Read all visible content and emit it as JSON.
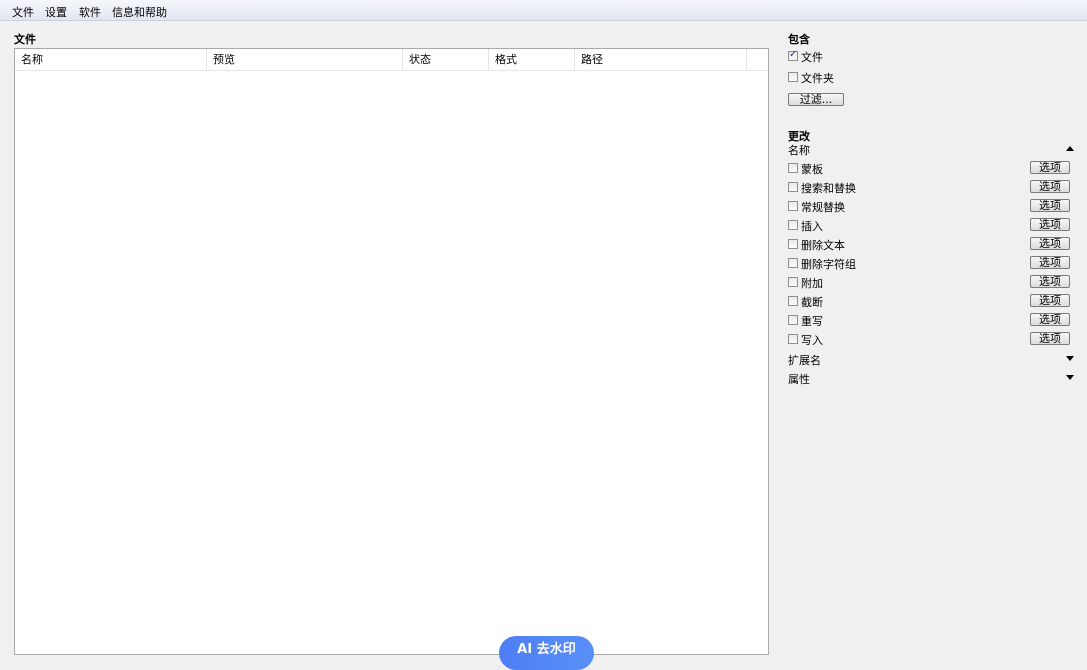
{
  "menu": [
    "文件",
    "设置",
    "软件",
    "信息和帮助"
  ],
  "files_section": {
    "title": "文件",
    "columns": [
      "名称",
      "预览",
      "状态",
      "格式",
      "路径"
    ]
  },
  "include_section": {
    "title": "包含",
    "files_label": "文件",
    "files_checked": true,
    "folders_label": "文件夹",
    "folders_checked": false,
    "filter_button": "过滤..."
  },
  "change_section": {
    "title": "更改",
    "name_heading": "名称",
    "options_label": "选项",
    "items": [
      "蒙板",
      "搜索和替换",
      "常规替换",
      "插入",
      "删除文本",
      "删除字符组",
      "附加",
      "截断",
      "重写",
      "写入"
    ],
    "extension_label": "扩展名",
    "attributes_label": "属性"
  },
  "overlay": {
    "ai_label": "AI 去水印"
  }
}
